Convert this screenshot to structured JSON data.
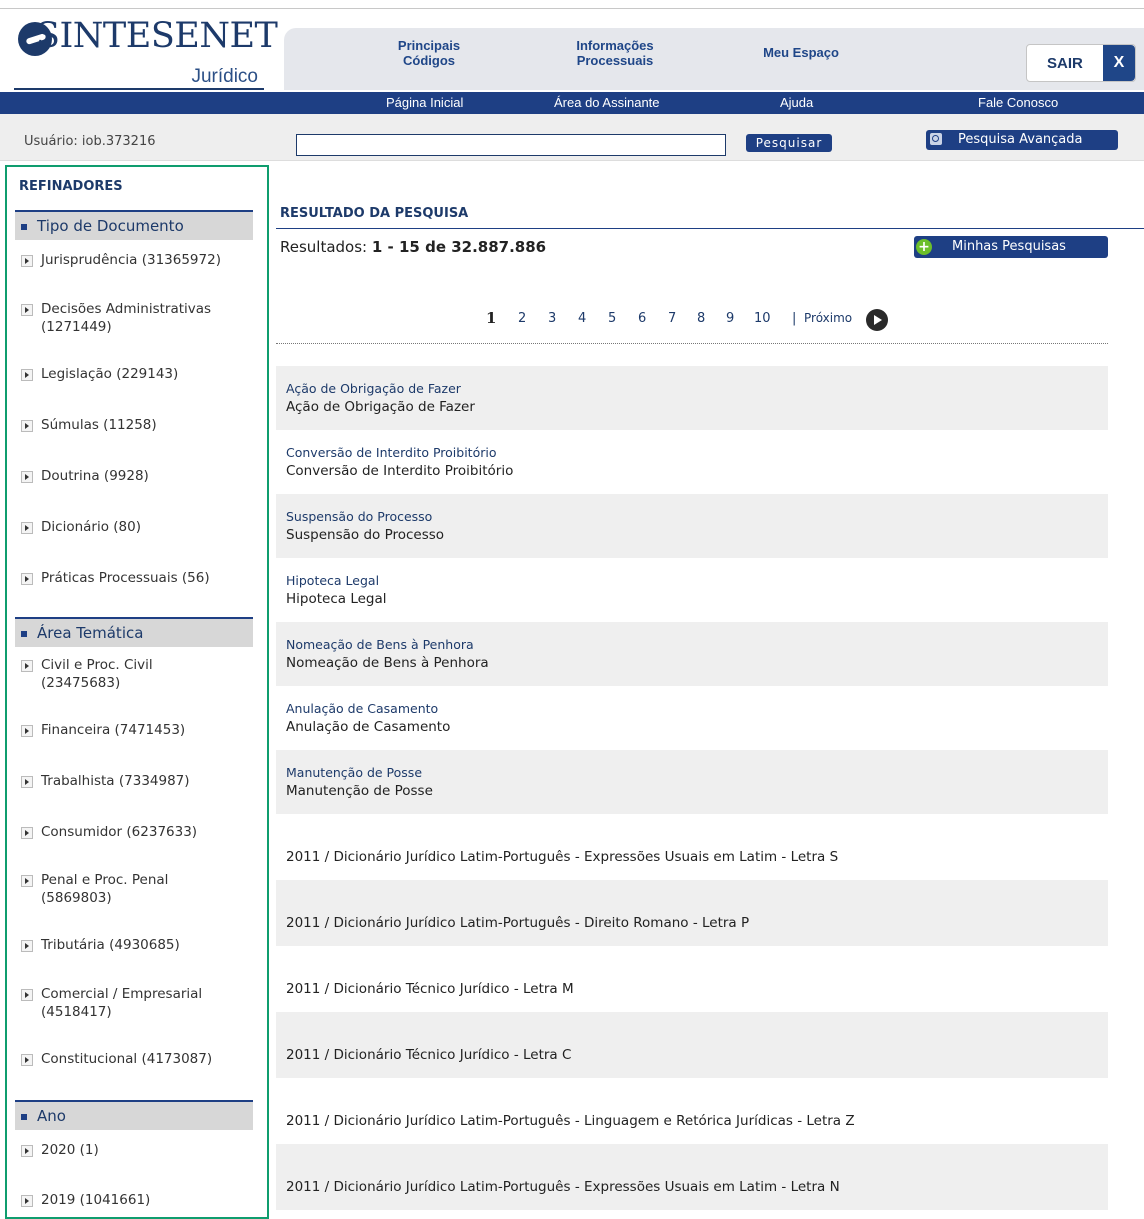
{
  "header": {
    "logo_brand": "SINTESENET",
    "logo_sub": "Jurídico",
    "nav_tabs": [
      {
        "line1": "Principais",
        "line2": "Códigos"
      },
      {
        "line1": "Informações",
        "line2": "Processuais"
      },
      {
        "line1": "Meu Espaço",
        "line2": ""
      }
    ],
    "logout_label": "SAIR",
    "logout_x": "X"
  },
  "bluebar": {
    "links": [
      "Página Inicial",
      "Área do Assinante",
      "Ajuda",
      "Fale Conosco"
    ]
  },
  "userbar": {
    "user_text": "Usuário:  iob.373216",
    "search_value": "",
    "search_button": "Pesquisar",
    "advanced_button": "Pesquisa Avançada"
  },
  "sidebar": {
    "title": "REFINADORES",
    "sections": [
      {
        "title": "Tipo de Documento",
        "items": [
          {
            "line1": "Jurisprudência (31365972)",
            "line2": ""
          },
          {
            "line1": "Decisões Administrativas",
            "line2": "(1271449)"
          },
          {
            "line1": "Legislação (229143)",
            "line2": ""
          },
          {
            "line1": "Súmulas (11258)",
            "line2": ""
          },
          {
            "line1": "Doutrina (9928)",
            "line2": ""
          },
          {
            "line1": "Dicionário (80)",
            "line2": ""
          },
          {
            "line1": "Práticas Processuais (56)",
            "line2": ""
          }
        ]
      },
      {
        "title": "Área Temática",
        "items": [
          {
            "line1": "Civil e Proc. Civil",
            "line2": "(23475683)"
          },
          {
            "line1": "Financeira (7471453)",
            "line2": ""
          },
          {
            "line1": "Trabalhista (7334987)",
            "line2": ""
          },
          {
            "line1": "Consumidor (6237633)",
            "line2": ""
          },
          {
            "line1": "Penal e Proc. Penal",
            "line2": "(5869803)"
          },
          {
            "line1": "Tributária (4930685)",
            "line2": ""
          },
          {
            "line1": "Comercial / Empresarial",
            "line2": "(4518417)"
          },
          {
            "line1": "Constitucional (4173087)",
            "line2": ""
          }
        ]
      },
      {
        "title": "Ano",
        "items": [
          {
            "line1": "2020 (1)",
            "line2": ""
          },
          {
            "line1": "2019 (1041661)",
            "line2": ""
          }
        ]
      }
    ]
  },
  "results": {
    "section_title": "RESULTADO DA PESQUISA",
    "count_label": "Resultados:",
    "count_value": "1 - 15 de 32.887.886",
    "my_searches_button": "Minhas Pesquisas",
    "pagination": {
      "current": "1",
      "pages": [
        "2",
        "3",
        "4",
        "5",
        "6",
        "7",
        "8",
        "9",
        "10"
      ],
      "separator": "|",
      "next_label": "Próximo"
    },
    "rows": [
      {
        "link": "Ação de Obrigação de Fazer",
        "desc": "Ação de Obrigação de Fazer"
      },
      {
        "link": "Conversão de Interdito Proibitório",
        "desc": "Conversão de Interdito Proibitório"
      },
      {
        "link": "Suspensão do Processo",
        "desc": "Suspensão do Processo"
      },
      {
        "link": "Hipoteca Legal",
        "desc": "Hipoteca Legal"
      },
      {
        "link": "Nomeação de Bens à Penhora",
        "desc": "Nomeação de Bens à Penhora"
      },
      {
        "link": "Anulação de Casamento",
        "desc": "Anulação de Casamento"
      },
      {
        "link": "Manutenção de Posse",
        "desc": "Manutenção de Posse"
      },
      {
        "link": "",
        "desc": "2011 / Dicionário Jurídico Latim-Português - Expressões Usuais em Latim - Letra S"
      },
      {
        "link": "",
        "desc": "2011 / Dicionário Jurídico Latim-Português - Direito Romano - Letra P"
      },
      {
        "link": "",
        "desc": "2011 / Dicionário Técnico Jurídico - Letra M"
      },
      {
        "link": "",
        "desc": "2011 / Dicionário Técnico Jurídico - Letra C"
      },
      {
        "link": "",
        "desc": "2011 / Dicionário Jurídico Latim-Português - Linguagem e Retórica Jurídicas - Letra Z"
      },
      {
        "link": "",
        "desc": "2011 / Dicionário Jurídico Latim-Português - Expressões Usuais em Latim - Letra N"
      }
    ]
  }
}
